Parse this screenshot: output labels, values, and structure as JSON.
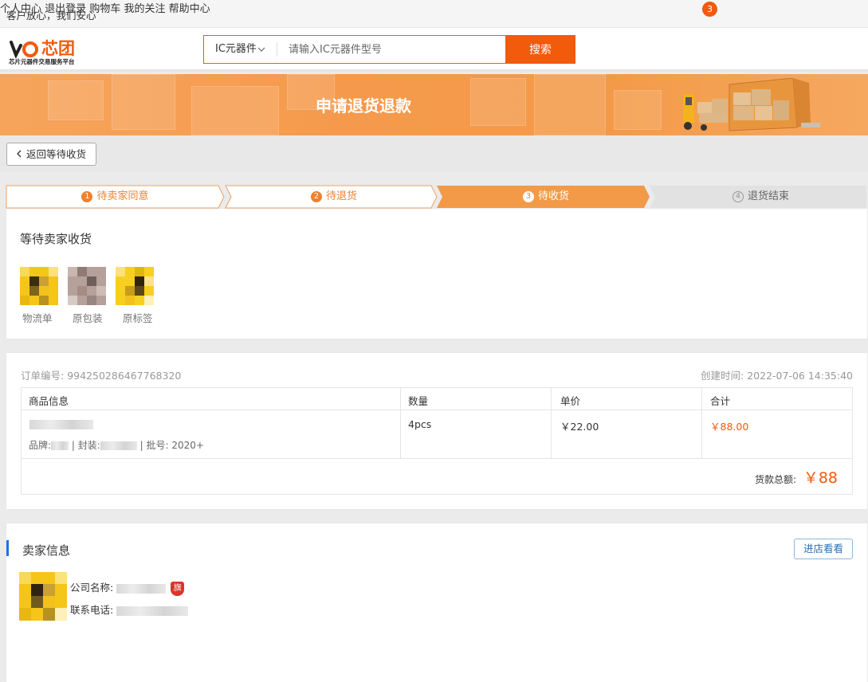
{
  "topbar": {
    "slogan": "客户放心，我们安心",
    "nav": [
      "个人中心",
      "退出登录",
      "购物车",
      "我的关注",
      "帮助中心"
    ],
    "cart_count": "3"
  },
  "header": {
    "logo_sub": "芯片元器件交易服务平台",
    "search_category": "IC元器件",
    "search_placeholder": "请输入IC元器件型号",
    "search_button": "搜索"
  },
  "banner": {
    "title": "申请退货退款"
  },
  "back_button": "返回等待收货",
  "steps": [
    {
      "num": "1",
      "label": "待卖家同意",
      "state": "done"
    },
    {
      "num": "2",
      "label": "待退货",
      "state": "done"
    },
    {
      "num": "3",
      "label": "待收货",
      "state": "active"
    },
    {
      "num": "4",
      "label": "退货结束",
      "state": "todo"
    }
  ],
  "status": {
    "heading": "等待卖家收货",
    "attachments": [
      "物流单",
      "原包装",
      "原标签"
    ]
  },
  "order": {
    "order_no_label": "订单编号:",
    "order_no": "994250286467768320",
    "created_label": "创建时间:",
    "created_at": "2022-07-06 14:35:40",
    "columns": [
      "商品信息",
      "数量",
      "单价",
      "合计"
    ],
    "item": {
      "brand_label": "品牌:",
      "package_label": "封装:",
      "batch_label": "批号:",
      "batch": "2020+",
      "quantity": "4pcs",
      "unit_price": "￥22.00",
      "subtotal": "￥88.00"
    },
    "total_label": "货款总额:",
    "total": "￥88"
  },
  "seller": {
    "heading": "卖家信息",
    "shop_button": "进店看看",
    "company_label": "公司名称:",
    "flag": "旗",
    "phone_label": "联系电话:"
  },
  "colors": {
    "accent": "#f25a0c",
    "step_orange": "#f0812e",
    "blue": "#1a73e8"
  }
}
